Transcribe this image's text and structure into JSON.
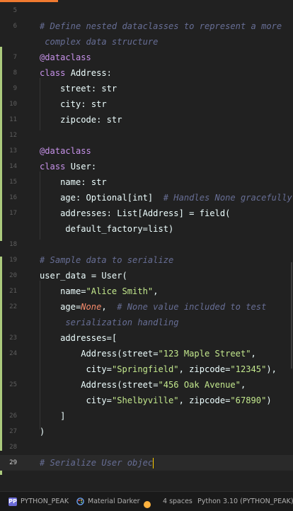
{
  "editor": {
    "current_line": "29",
    "lines": [
      {
        "num": "5",
        "text": ""
      },
      {
        "num": "6",
        "text": "# Define nested dataclasses to represent a more"
      },
      {
        "num": "",
        "text": " complex data structure"
      },
      {
        "num": "7",
        "text": "@dataclass"
      },
      {
        "num": "8",
        "text": "class Address:"
      },
      {
        "num": "9",
        "text": "    street: str"
      },
      {
        "num": "10",
        "text": "    city: str"
      },
      {
        "num": "11",
        "text": "    zipcode: str"
      },
      {
        "num": "12",
        "text": ""
      },
      {
        "num": "13",
        "text": "@dataclass"
      },
      {
        "num": "14",
        "text": "class User:"
      },
      {
        "num": "15",
        "text": "    name: str"
      },
      {
        "num": "16",
        "text": "    age: Optional[int]  # Handles None gracefully"
      },
      {
        "num": "17",
        "text": "    addresses: List[Address] = field("
      },
      {
        "num": "",
        "text": "     default_factory=list)"
      },
      {
        "num": "18",
        "text": ""
      },
      {
        "num": "19",
        "text": "# Sample data to serialize"
      },
      {
        "num": "20",
        "text": "user_data = User("
      },
      {
        "num": "21",
        "text": "    name=\"Alice Smith\","
      },
      {
        "num": "22",
        "text": "    age=None,  # None value included to test"
      },
      {
        "num": "",
        "text": "     serialization handling"
      },
      {
        "num": "23",
        "text": "    addresses=["
      },
      {
        "num": "24",
        "text": "        Address(street=\"123 Maple Street\","
      },
      {
        "num": "",
        "text": "         city=\"Springfield\", zipcode=\"12345\"),"
      },
      {
        "num": "25",
        "text": "        Address(street=\"456 Oak Avenue\","
      },
      {
        "num": "",
        "text": "         city=\"Shelbyville\", zipcode=\"67890\")"
      },
      {
        "num": "26",
        "text": "    ]"
      },
      {
        "num": "27",
        "text": ")"
      },
      {
        "num": "28",
        "text": ""
      },
      {
        "num": "29",
        "text": "# Serialize User objec"
      }
    ]
  },
  "statusbar": {
    "project_icon": "PP",
    "project": "PYTHON_PEAK",
    "theme_icon": "palette-icon",
    "theme": "Material Darker",
    "notification_icon": "notification-dot-icon",
    "indent": "4 spaces",
    "interpreter_icon": "python-icon",
    "interpreter": "Python 3.10 (PYTHON_PEAK)"
  },
  "colors": {
    "background": "#212121",
    "accent": "#f07a30",
    "comment": "#676e95",
    "keyword": "#c792ea",
    "string": "#c3e88d",
    "constant": "#f78c6c"
  }
}
